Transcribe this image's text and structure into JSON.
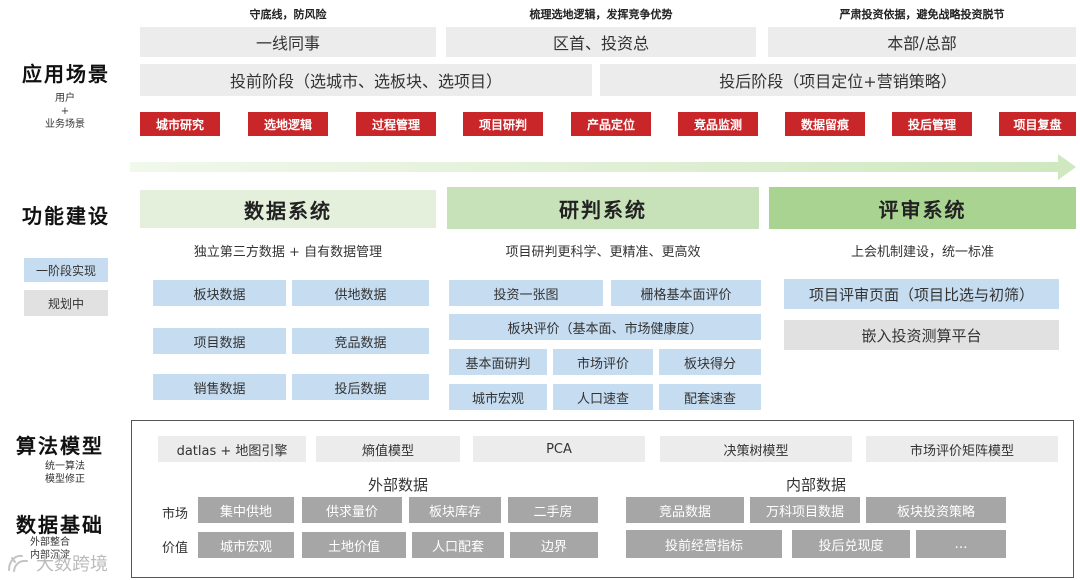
{
  "rows": [
    {
      "title": "应用场景",
      "sub": [
        "用户",
        "+",
        "业务场景"
      ]
    },
    {
      "title": "功能建设",
      "sub": []
    },
    {
      "title": "算法模型",
      "sub": [
        "统一算法",
        "模型修正"
      ]
    },
    {
      "title": "数据基础",
      "sub": [
        "外部整合",
        "内部沉淀"
      ]
    }
  ],
  "legend": {
    "implemented": "一阶段实现",
    "planning": "规划中"
  },
  "top_notes": [
    "守底线，防风险",
    "梳理选地逻辑，发挥竞争优势",
    "严肃投资依据，避免战略投资脱节"
  ],
  "users": [
    "一线同事",
    "区首、投资总",
    "本部/总部"
  ],
  "phases": [
    "投前阶段（选城市、选板块、选项目）",
    "投后阶段（项目定位+营销策略）"
  ],
  "scenarios": [
    "城市研究",
    "选地逻辑",
    "过程管理",
    "项目研判",
    "产品定位",
    "竞品监测",
    "数据留痕",
    "投后管理",
    "项目复盘"
  ],
  "systems": [
    {
      "title": "数据系统",
      "desc": "独立第三方数据 + 自有数据管理",
      "items": [
        "板块数据",
        "供地数据",
        "项目数据",
        "竞品数据",
        "销售数据",
        "投后数据"
      ]
    },
    {
      "title": "研判系统",
      "desc": "项目研判更科学、更精准、更高效",
      "items": [
        "投资一张图",
        "栅格基本面评价",
        "板块评价（基本面、市场健康度）",
        "基本面研判",
        "市场评价",
        "板块得分",
        "城市宏观",
        "人口速查",
        "配套速查"
      ]
    },
    {
      "title": "评审系统",
      "desc": "上会机制建设，统一标准",
      "items": [
        "项目评审页面（项目比选与初筛）",
        "嵌入投资测算平台"
      ]
    }
  ],
  "models": [
    "datlas + 地图引擎",
    "熵值模型",
    "PCA",
    "决策树模型",
    "市场评价矩阵模型"
  ],
  "external": {
    "title": "外部数据",
    "side": [
      "市场",
      "价值"
    ],
    "row1": [
      "集中供地",
      "供求量价",
      "板块库存",
      "二手房"
    ],
    "row2": [
      "城市宏观",
      "土地价值",
      "人口配套",
      "边界"
    ]
  },
  "internal": {
    "title": "内部数据",
    "row1": [
      "竞品数据",
      "万科项目数据",
      "板块投资策略"
    ],
    "row2": [
      "投前经营指标",
      "投后兑现度",
      "…"
    ]
  },
  "watermark": "大数跨境",
  "colors": {
    "red": "#c9262a",
    "blue": "#c6dcf1",
    "green_light": "#e4f0dc",
    "green_mid": "#c7e2b8",
    "green_dark": "#a8d390",
    "data_grey": "#a6a6a6"
  }
}
